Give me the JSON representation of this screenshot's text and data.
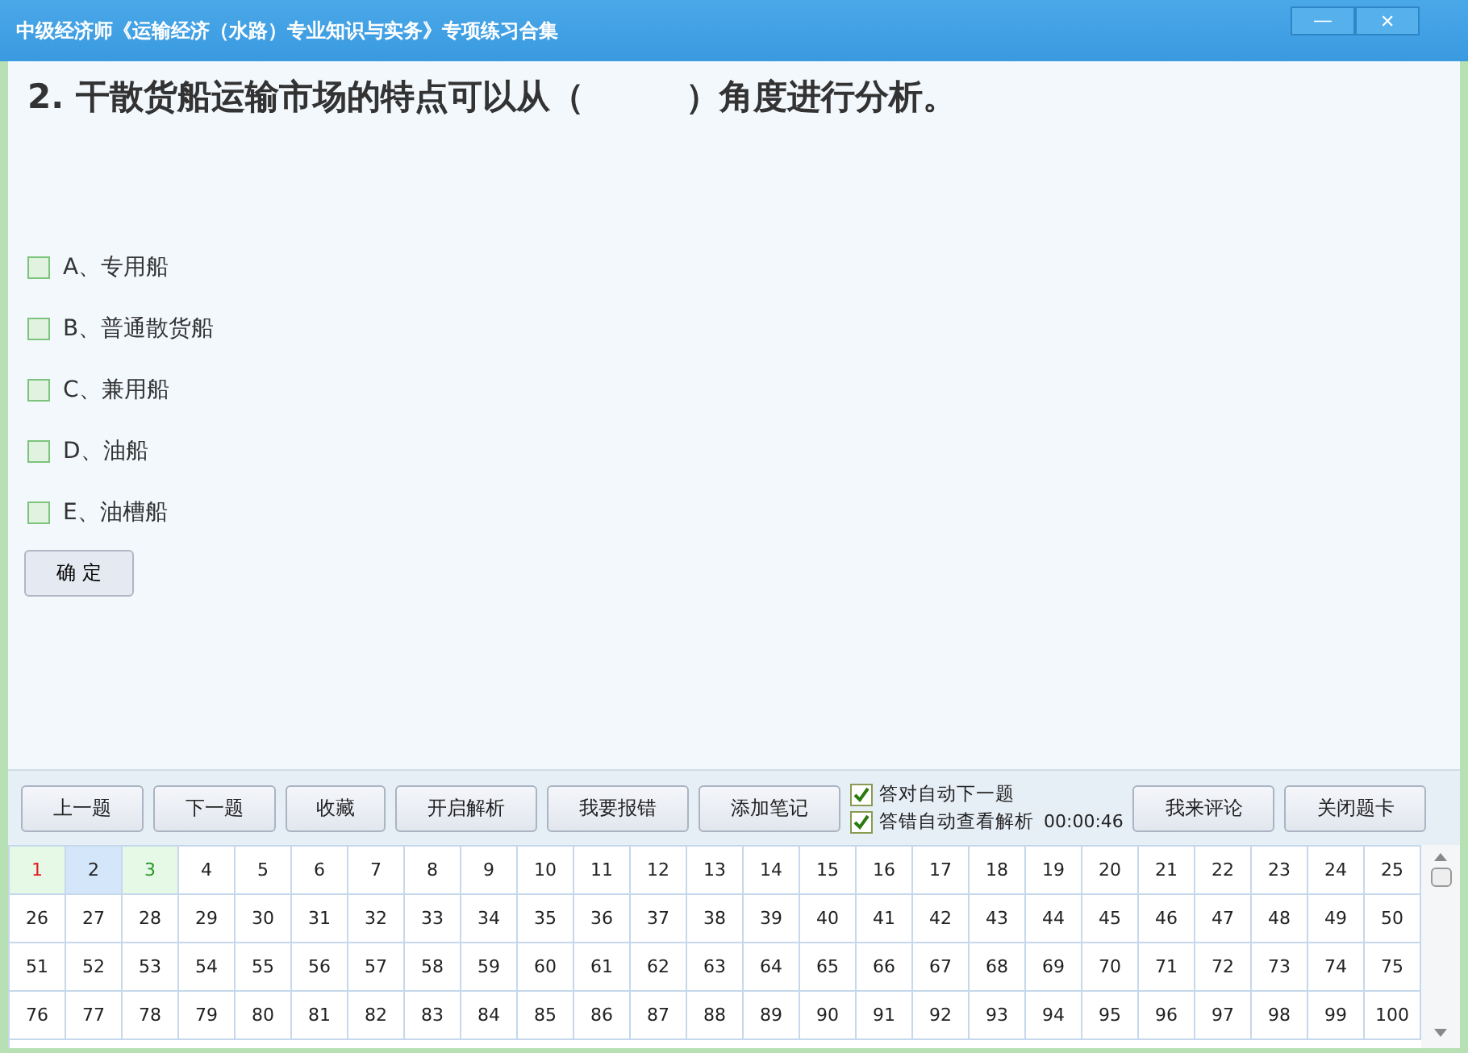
{
  "window": {
    "title": "中级经济师《运输经济（水路）专业知识与实务》专项练习合集",
    "controls": [
      "—",
      "✕"
    ]
  },
  "question": {
    "text": "2. 干散货船运输市场的特点可以从（　　　）角度进行分析。"
  },
  "options": [
    {
      "label": "A、专用船",
      "checked": false
    },
    {
      "label": "B、普通散货船",
      "checked": false
    },
    {
      "label": "C、兼用船",
      "checked": false
    },
    {
      "label": "D、油船",
      "checked": false
    },
    {
      "label": "E、油槽船",
      "checked": false
    }
  ],
  "confirm_button": "确 定",
  "toolbar": {
    "buttons": [
      "上一题",
      "下一题",
      "收藏",
      "开启解析",
      "我要报错",
      "添加笔记"
    ],
    "toggles": [
      {
        "label": "答对自动下一题",
        "checked": true
      },
      {
        "label": "答错自动查看解析",
        "checked": true
      }
    ],
    "timer": "00:00:46",
    "right_buttons": [
      "我来评论",
      "关闭题卡"
    ]
  },
  "answer_card": [
    {
      "label": "1",
      "kind": "wrong",
      "selected": false
    },
    {
      "label": "2",
      "kind": "plain",
      "selected": true
    },
    {
      "label": "3",
      "kind": "correct",
      "selected": false
    },
    {
      "label": "4",
      "kind": "plain",
      "selected": false
    },
    {
      "label": "5",
      "kind": "plain",
      "selected": false
    },
    {
      "label": "6",
      "kind": "plain",
      "selected": false
    },
    {
      "label": "7",
      "kind": "plain",
      "selected": false
    },
    {
      "label": "8",
      "kind": "plain",
      "selected": false
    },
    {
      "label": "9",
      "kind": "plain",
      "selected": false
    },
    {
      "label": "10",
      "kind": "plain",
      "selected": false
    },
    {
      "label": "11",
      "kind": "plain",
      "selected": false
    },
    {
      "label": "12",
      "kind": "plain",
      "selected": false
    },
    {
      "label": "13",
      "kind": "plain",
      "selected": false
    },
    {
      "label": "14",
      "kind": "plain",
      "selected": false
    },
    {
      "label": "15",
      "kind": "plain",
      "selected": false
    },
    {
      "label": "16",
      "kind": "plain",
      "selected": false
    },
    {
      "label": "17",
      "kind": "plain",
      "selected": false
    },
    {
      "label": "18",
      "kind": "plain",
      "selected": false
    },
    {
      "label": "19",
      "kind": "plain",
      "selected": false
    },
    {
      "label": "20",
      "kind": "plain",
      "selected": false
    },
    {
      "label": "21",
      "kind": "plain",
      "selected": false
    },
    {
      "label": "22",
      "kind": "plain",
      "selected": false
    },
    {
      "label": "23",
      "kind": "plain",
      "selected": false
    },
    {
      "label": "24",
      "kind": "plain",
      "selected": false
    },
    {
      "label": "25",
      "kind": "plain",
      "selected": false
    },
    {
      "label": "26",
      "kind": "plain",
      "selected": false
    },
    {
      "label": "27",
      "kind": "plain",
      "selected": false
    },
    {
      "label": "28",
      "kind": "plain",
      "selected": false
    },
    {
      "label": "29",
      "kind": "plain",
      "selected": false
    },
    {
      "label": "30",
      "kind": "plain",
      "selected": false
    },
    {
      "label": "31",
      "kind": "plain",
      "selected": false
    },
    {
      "label": "32",
      "kind": "plain",
      "selected": false
    },
    {
      "label": "33",
      "kind": "plain",
      "selected": false
    },
    {
      "label": "34",
      "kind": "plain",
      "selected": false
    },
    {
      "label": "35",
      "kind": "plain",
      "selected": false
    },
    {
      "label": "36",
      "kind": "plain",
      "selected": false
    },
    {
      "label": "37",
      "kind": "plain",
      "selected": false
    },
    {
      "label": "38",
      "kind": "plain",
      "selected": false
    },
    {
      "label": "39",
      "kind": "plain",
      "selected": false
    },
    {
      "label": "40",
      "kind": "plain",
      "selected": false
    },
    {
      "label": "41",
      "kind": "plain",
      "selected": false
    },
    {
      "label": "42",
      "kind": "plain",
      "selected": false
    },
    {
      "label": "43",
      "kind": "plain",
      "selected": false
    },
    {
      "label": "44",
      "kind": "plain",
      "selected": false
    },
    {
      "label": "45",
      "kind": "plain",
      "selected": false
    },
    {
      "label": "46",
      "kind": "plain",
      "selected": false
    },
    {
      "label": "47",
      "kind": "plain",
      "selected": false
    },
    {
      "label": "48",
      "kind": "plain",
      "selected": false
    },
    {
      "label": "49",
      "kind": "plain",
      "selected": false
    },
    {
      "label": "50",
      "kind": "plain",
      "selected": false
    },
    {
      "label": "51",
      "kind": "plain",
      "selected": false
    },
    {
      "label": "52",
      "kind": "plain",
      "selected": false
    },
    {
      "label": "53",
      "kind": "plain",
      "selected": false
    },
    {
      "label": "54",
      "kind": "plain",
      "selected": false
    },
    {
      "label": "55",
      "kind": "plain",
      "selected": false
    },
    {
      "label": "56",
      "kind": "plain",
      "selected": false
    },
    {
      "label": "57",
      "kind": "plain",
      "selected": false
    },
    {
      "label": "58",
      "kind": "plain",
      "selected": false
    },
    {
      "label": "59",
      "kind": "plain",
      "selected": false
    },
    {
      "label": "60",
      "kind": "plain",
      "selected": false
    },
    {
      "label": "61",
      "kind": "plain",
      "selected": false
    },
    {
      "label": "62",
      "kind": "plain",
      "selected": false
    },
    {
      "label": "63",
      "kind": "plain",
      "selected": false
    },
    {
      "label": "64",
      "kind": "plain",
      "selected": false
    },
    {
      "label": "65",
      "kind": "plain",
      "selected": false
    },
    {
      "label": "66",
      "kind": "plain",
      "selected": false
    },
    {
      "label": "67",
      "kind": "plain",
      "selected": false
    },
    {
      "label": "68",
      "kind": "plain",
      "selected": false
    },
    {
      "label": "69",
      "kind": "plain",
      "selected": false
    },
    {
      "label": "70",
      "kind": "plain",
      "selected": false
    },
    {
      "label": "71",
      "kind": "plain",
      "selected": false
    },
    {
      "label": "72",
      "kind": "plain",
      "selected": false
    },
    {
      "label": "73",
      "kind": "plain",
      "selected": false
    },
    {
      "label": "74",
      "kind": "plain",
      "selected": false
    },
    {
      "label": "75",
      "kind": "plain",
      "selected": false
    },
    {
      "label": "76",
      "kind": "plain",
      "selected": false
    },
    {
      "label": "77",
      "kind": "plain",
      "selected": false
    },
    {
      "label": "78",
      "kind": "plain",
      "selected": false
    },
    {
      "label": "79",
      "kind": "plain",
      "selected": false
    },
    {
      "label": "80",
      "kind": "plain",
      "selected": false
    },
    {
      "label": "81",
      "kind": "plain",
      "selected": false
    },
    {
      "label": "82",
      "kind": "plain",
      "selected": false
    },
    {
      "label": "83",
      "kind": "plain",
      "selected": false
    },
    {
      "label": "84",
      "kind": "plain",
      "selected": false
    },
    {
      "label": "85",
      "kind": "plain",
      "selected": false
    },
    {
      "label": "86",
      "kind": "plain",
      "selected": false
    },
    {
      "label": "87",
      "kind": "plain",
      "selected": false
    },
    {
      "label": "88",
      "kind": "plain",
      "selected": false
    },
    {
      "label": "89",
      "kind": "plain",
      "selected": false
    },
    {
      "label": "90",
      "kind": "plain",
      "selected": false
    },
    {
      "label": "91",
      "kind": "plain",
      "selected": false
    },
    {
      "label": "92",
      "kind": "plain",
      "selected": false
    },
    {
      "label": "93",
      "kind": "plain",
      "selected": false
    },
    {
      "label": "94",
      "kind": "plain",
      "selected": false
    },
    {
      "label": "95",
      "kind": "plain",
      "selected": false
    },
    {
      "label": "96",
      "kind": "plain",
      "selected": false
    },
    {
      "label": "97",
      "kind": "plain",
      "selected": false
    },
    {
      "label": "98",
      "kind": "plain",
      "selected": false
    },
    {
      "label": "99",
      "kind": "plain",
      "selected": false
    },
    {
      "label": "100",
      "kind": "plain",
      "selected": false
    }
  ]
}
